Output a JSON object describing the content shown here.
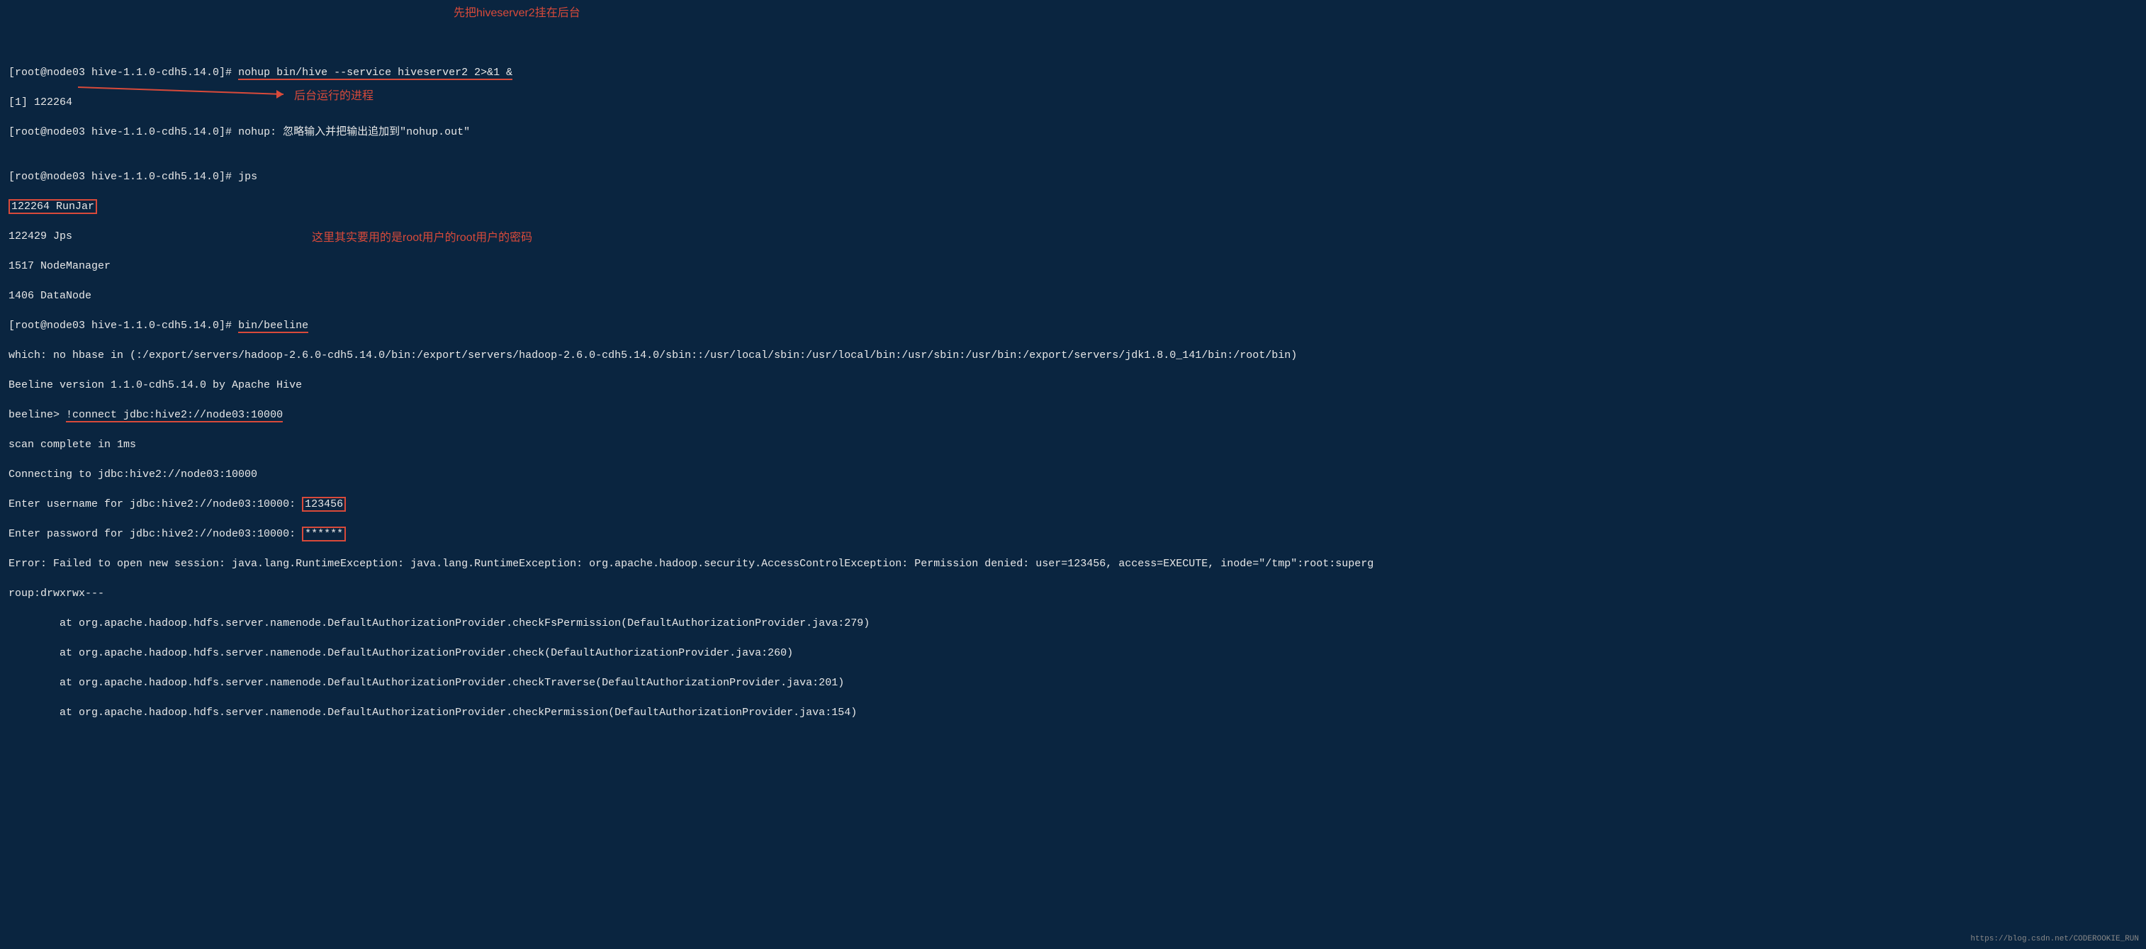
{
  "prompt_prefix": "[root@node03 hive-1.1.0-cdh5.14.0]# ",
  "lines": {
    "l1_cmd": "nohup bin/hive --service hiveserver2 2>&1 &",
    "l2": "[1] 122264",
    "l3_cmd": "nohup: 忽略输入并把输出追加到\"nohup.out\"",
    "l4": "",
    "l5_cmd": "jps",
    "l6": "122264 RunJar",
    "l7": "122429 Jps",
    "l8": "1517 NodeManager",
    "l9": "1406 DataNode",
    "l10_cmd": "bin/beeline",
    "l11": "which: no hbase in (:/export/servers/hadoop-2.6.0-cdh5.14.0/bin:/export/servers/hadoop-2.6.0-cdh5.14.0/sbin::/usr/local/sbin:/usr/local/bin:/usr/sbin:/usr/bin:/export/servers/jdk1.8.0_141/bin:/root/bin)",
    "l12": "Beeline version 1.1.0-cdh5.14.0 by Apache Hive",
    "l13_prefix": "beeline> ",
    "l13_cmd": "!connect jdbc:hive2://node03:10000",
    "l14": "scan complete in 1ms",
    "l15": "Connecting to jdbc:hive2://node03:10000",
    "l16_prefix": "Enter username for jdbc:hive2://node03:10000: ",
    "l16_val": "123456",
    "l17_prefix": "Enter password for jdbc:hive2://node03:10000: ",
    "l17_val": "******",
    "l18": "Error: Failed to open new session: java.lang.RuntimeException: java.lang.RuntimeException: org.apache.hadoop.security.AccessControlException: Permission denied: user=123456, access=EXECUTE, inode=\"/tmp\":root:superg",
    "l19": "roup:drwxrwx---",
    "l20": "        at org.apache.hadoop.hdfs.server.namenode.DefaultAuthorizationProvider.checkFsPermission(DefaultAuthorizationProvider.java:279)",
    "l21": "        at org.apache.hadoop.hdfs.server.namenode.DefaultAuthorizationProvider.check(DefaultAuthorizationProvider.java:260)",
    "l22": "        at org.apache.hadoop.hdfs.server.namenode.DefaultAuthorizationProvider.checkTraverse(DefaultAuthorizationProvider.java:201)",
    "l23": "        at org.apache.hadoop.hdfs.server.namenode.DefaultAuthorizationProvider.checkPermission(DefaultAuthorizationProvider.java:154)"
  },
  "annotations": {
    "a1": "先把hiveserver2挂在后台",
    "a2": "后台运行的进程",
    "a3": "这里其实要用的是root用户的root用户的密码"
  },
  "watermark": "https://blog.csdn.net/CODEROOKIE_RUN"
}
